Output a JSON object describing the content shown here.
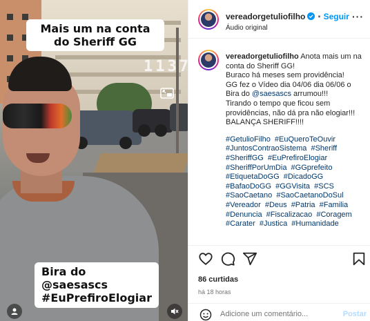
{
  "video": {
    "caption_top": "Mais um na conta do Sheriff GG",
    "caption_bottom_line1": "Bira do @saesascs",
    "caption_bottom_line2": "#EuPrefiroElogiar",
    "watermark": "1137",
    "icons": {
      "pip": "picture-in-picture-icon",
      "user": "user-icon",
      "sound": "sound-off-icon"
    }
  },
  "header": {
    "username": "vereadorgetuliofilho",
    "follow_label": "Seguir",
    "audio_label": "Áudio original",
    "more_icon": "more-icon"
  },
  "caption": {
    "username": "vereadorgetuliofilho",
    "line1": "Anota mais um na conta do Sheriff GG!",
    "line2": "Buraco há meses sem providência!",
    "line3": "GG fez o Vídeo dia 04/06 dia 06/06 o Bira do",
    "mention": "@saesascs",
    "line3b": "arrumou!!!",
    "line4": "Tirando o tempo que ficou sem providências, não dá pra não elogiar!!!",
    "line5": "BALANÇA SHERIFF!!!!",
    "hashtags": [
      "#GetulioFilho",
      "#EuQueroTeOuvir",
      "#JuntosContraoSistema",
      "#Sheriff",
      "#SheriffGG",
      "#EuPrefiroElogiar",
      "#SheriffPorUmDia",
      "#GGprefeito",
      "#EtiquetaDoGG",
      "#DicadoGG",
      "#BafaoDoGG",
      "#GGVisita",
      "#SCS",
      "#SaoCaetano",
      "#SaoCaetanoDoSul",
      "#Vereador",
      "#Deus",
      "#Patria",
      "#Familia",
      "#Denuncia",
      "#Fiscalizacao",
      "#Coragem",
      "#Carater",
      "#Justica",
      "#Humanidade"
    ]
  },
  "actions": {
    "likes": "86 curtidas",
    "time": "há 18 horas",
    "comment_placeholder": "Adicione um comentário...",
    "post_label": "Postar",
    "icons": [
      "heart-icon",
      "comment-icon",
      "share-icon",
      "bookmark-icon",
      "emoji-icon"
    ]
  },
  "colors": {
    "link": "#00376b",
    "follow": "#0095f6",
    "post_disabled": "#b3dbff"
  }
}
